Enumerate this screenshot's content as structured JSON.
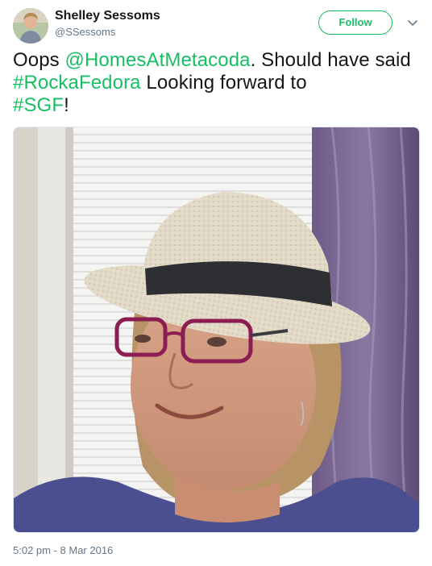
{
  "author": {
    "name": "Shelley Sessoms",
    "handle": "@SSessoms",
    "avatar_icon": "profile-photo"
  },
  "follow_button": {
    "label": "Follow",
    "color": "#17bf63"
  },
  "menu_icon": "chevron-down-icon",
  "tweet": {
    "segments": [
      {
        "type": "text",
        "value": "Oops "
      },
      {
        "type": "mention",
        "value": "@HomesAtMetacoda"
      },
      {
        "type": "text",
        "value": ". Should have said "
      },
      {
        "type": "hashtag",
        "value": "#RockaFedora"
      },
      {
        "type": "text",
        "value": " Looking forward to "
      },
      {
        "type": "hashtag",
        "value": "#SGF"
      },
      {
        "type": "text",
        "value": "!"
      }
    ],
    "link_color": "#17bf63"
  },
  "media": {
    "type": "photo",
    "subject": "selfie-woman-in-fedora-hat"
  },
  "timestamp": "5:02 pm - 8 Mar 2016"
}
